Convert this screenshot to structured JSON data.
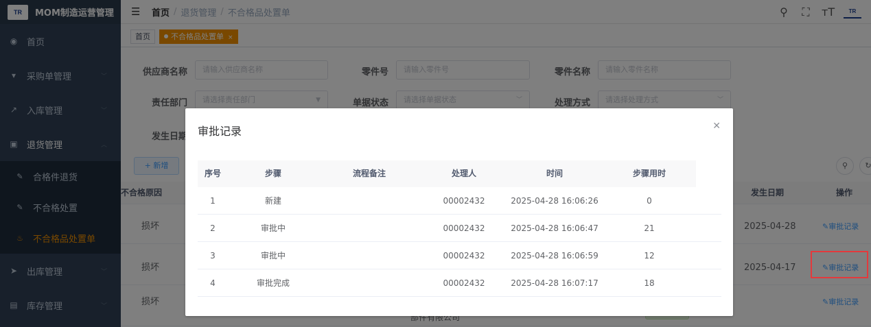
{
  "app": {
    "logo_text": "TR",
    "title": "MOM制造运营管理"
  },
  "sidebar": {
    "items": [
      {
        "label": "首页",
        "icon": "dashboard-icon"
      },
      {
        "label": "采购单管理",
        "icon": "cart-icon"
      },
      {
        "label": "入库管理",
        "icon": "import-icon"
      },
      {
        "label": "退货管理",
        "icon": "return-icon"
      },
      {
        "label": "出库管理",
        "icon": "send-icon"
      },
      {
        "label": "库存管理",
        "icon": "inventory-icon"
      }
    ],
    "sub_items": [
      {
        "label": "合格件退货"
      },
      {
        "label": "不合格处置"
      },
      {
        "label": "不合格品处置单"
      }
    ]
  },
  "header": {
    "breadcrumb": [
      "首页",
      "退货管理",
      "不合格品处置单"
    ]
  },
  "tags": {
    "home": "首页",
    "active": "不合格品处置单"
  },
  "filters": {
    "supplier_label": "供应商名称",
    "supplier_placeholder": "请输入供应商名称",
    "part_no_label": "零件号",
    "part_no_placeholder": "请输入零件号",
    "part_name_label": "零件名称",
    "part_name_placeholder": "请输入零件名称",
    "dept_label": "责任部门",
    "dept_placeholder": "请选择责任部门",
    "status_label": "单据状态",
    "status_placeholder": "请选择单据状态",
    "method_label": "处理方式",
    "method_placeholder": "请选择处理方式",
    "date_label": "发生日期"
  },
  "toolbar": {
    "add_label": "+ 新增"
  },
  "table": {
    "headers": {
      "reason": "不合格原因",
      "date": "发生日期",
      "actions": "操作"
    },
    "rows": [
      {
        "reason": "损坏",
        "date": "2025-04-28",
        "action": "审批记录"
      },
      {
        "reason": "损坏",
        "date": "2025-04-17",
        "action": "审批记录"
      },
      {
        "reason": "损坏",
        "date": "",
        "action": "审批记录"
      }
    ],
    "partial_company": "部件有限公司"
  },
  "modal": {
    "title": "审批记录",
    "columns": [
      "序号",
      "步骤",
      "流程备注",
      "处理人",
      "时间",
      "步骤用时"
    ],
    "rows": [
      {
        "seq": "1",
        "step": "新建",
        "note": "",
        "handler": "00002432",
        "time": "2025-04-28 16:06:26",
        "duration": "0"
      },
      {
        "seq": "2",
        "step": "审批中",
        "note": "",
        "handler": "00002432",
        "time": "2025-04-28 16:06:47",
        "duration": "21"
      },
      {
        "seq": "3",
        "step": "审批中",
        "note": "",
        "handler": "00002432",
        "time": "2025-04-28 16:06:59",
        "duration": "12"
      },
      {
        "seq": "4",
        "step": "审批完成",
        "note": "",
        "handler": "00002432",
        "time": "2025-04-28 16:07:17",
        "duration": "18"
      }
    ]
  }
}
